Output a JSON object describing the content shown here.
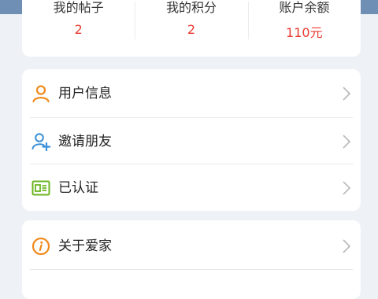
{
  "stats": [
    {
      "label": "我的帖子",
      "value": "2"
    },
    {
      "label": "我的积分",
      "value": "2"
    },
    {
      "label": "账户余额",
      "value": "110元"
    }
  ],
  "menu": {
    "group1": [
      {
        "label": "用户信息",
        "icon": "user-icon"
      },
      {
        "label": "邀请朋友",
        "icon": "add-user-icon"
      },
      {
        "label": "已认证",
        "icon": "id-card-icon"
      }
    ],
    "group2": [
      {
        "label": "关于爱家",
        "icon": "info-icon"
      }
    ]
  },
  "colors": {
    "accent_orange": "#f08a1c",
    "accent_blue": "#3a8fd8",
    "accent_green": "#6bb51f",
    "value_red": "#e83a2f",
    "header_blue": "#6f8fb4"
  }
}
